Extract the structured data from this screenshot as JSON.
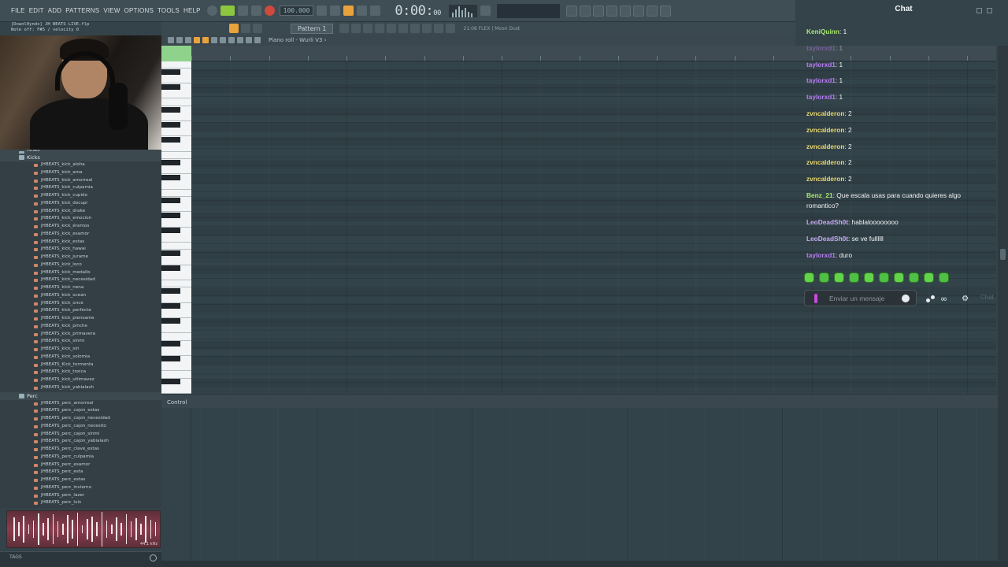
{
  "menu": [
    "FILE",
    "EDIT",
    "ADD",
    "PATTERNS",
    "VIEW",
    "OPTIONS",
    "TOOLS",
    "HELP"
  ],
  "transport": {
    "tempo": "100.000",
    "time": "0:00",
    "time_sub": "00"
  },
  "info": {
    "line1": "[Downl0ynds] JH BEATS LIVE.flp",
    "line2": "Note off: F#5 / velocity 0"
  },
  "subbar": {
    "pattern": "Pattern 1",
    "flex_label": "21:08 FLEX | Moon Dust"
  },
  "piano_roll": {
    "title": "Piano roll - Wurli V3 ›",
    "control_label": "Control"
  },
  "browser": {
    "partial_folder": "HiHats",
    "folders": [
      {
        "name": "Kicks",
        "files": [
          "JHBEATS_kick_aloha",
          "JHBEATS_kick_ama",
          "JHBEATS_kick_amorreal",
          "JHBEATS_kick_culpamia",
          "JHBEATS_kick_cupido",
          "JHBEATS_kick_docupi",
          "JHBEATS_kick_drake",
          "JHBEATS_kick_emocion",
          "JHBEATS_kick_éramos",
          "JHBEATS_kick_esamor",
          "JHBEATS_kick_estas",
          "JHBEATS_kick_hawai",
          "JHBEATS_kick_jurame",
          "JHBEATS_kick_loco",
          "JHBEATS_kick_medallo",
          "JHBEATS_kick_necesidad",
          "JHBEATS_kick_nena",
          "JHBEATS_kick_ocean",
          "JHBEATS_kick_once",
          "JHBEATS_kick_perfecta",
          "JHBEATS_kick_piensame",
          "JHBEATS_kick_pinche",
          "JHBEATS_kick_primavera",
          "JHBEATS_kick_sinmi",
          "JHBEATS_kick_siri",
          "JHBEATS_kick_solomia",
          "JHBEATS_Kick_tormenta",
          "JHBEATS_kick_toxica",
          "JHBEATS_kick_ultimavez",
          "JHBEATS_kick_yabialash"
        ]
      },
      {
        "name": "Perc",
        "files": [
          "JHBEATS_perc_amorreal",
          "JHBEATS_perc_cajon_estas",
          "JHBEATS_perc_cajon_necesidad",
          "JHBEATS_perc_cajon_necesito",
          "JHBEATS_perc_cajon_sinmi",
          "JHBEATS_perc_cajon_yabialash",
          "JHBEATS_perc_clave_estas",
          "JHBEATS_perc_culpamia",
          "JHBEATS_perc_esamor",
          "JHBEATS_perc_esta",
          "JHBEATS_perc_estas",
          "JHBEATS_perc_invierno",
          "JHBEATS_perc_lazer",
          "JHBEATS_perc_luis"
        ]
      }
    ],
    "bottom_label": "TAGS"
  },
  "chat": {
    "title": "Chat",
    "messages": [
      {
        "user": "KeniQuinn",
        "color": "#a9e86d",
        "text": "1",
        "faded": false
      },
      {
        "user": "taylorxd1",
        "color": "#b87cf3",
        "text": "1",
        "faded": true
      },
      {
        "user": "taylorxd1",
        "color": "#b87cf3",
        "text": "1",
        "faded": false
      },
      {
        "user": "taylorxd1",
        "color": "#b87cf3",
        "text": "1",
        "faded": false
      },
      {
        "user": "taylorxd1",
        "color": "#b87cf3",
        "text": "1",
        "faded": false
      },
      {
        "user": "zvncalderon",
        "color": "#e8d96e",
        "text": "2",
        "faded": false
      },
      {
        "user": "zvncalderon",
        "color": "#e8d96e",
        "text": "2",
        "faded": false
      },
      {
        "user": "zvncalderon",
        "color": "#e8d96e",
        "text": "2",
        "faded": false
      },
      {
        "user": "zvncalderon",
        "color": "#e8d96e",
        "text": "2",
        "faded": false
      },
      {
        "user": "zvncalderon",
        "color": "#e8d96e",
        "text": "2",
        "faded": false
      },
      {
        "user": "Benz_21",
        "color": "#a9e86d",
        "text": "Que escala usas para cuando quieres algo romantico?",
        "faded": false
      },
      {
        "user": "LeoDeadSh0t",
        "color": "#c5a8ee",
        "text": "hablaloooooooo",
        "faded": false
      },
      {
        "user": "LeoDeadSh0t",
        "color": "#c5a8ee",
        "text": "se ve fullllll",
        "faded": false
      },
      {
        "user": "taylorxd1",
        "color": "#b87cf3",
        "text": "duro",
        "faded": false
      }
    ],
    "input_placeholder": "Enviar un mensaje",
    "send_label": "Chat"
  },
  "icons": [
    "smile-icon",
    "gear-icon",
    "bits-icon",
    "search-icon"
  ]
}
